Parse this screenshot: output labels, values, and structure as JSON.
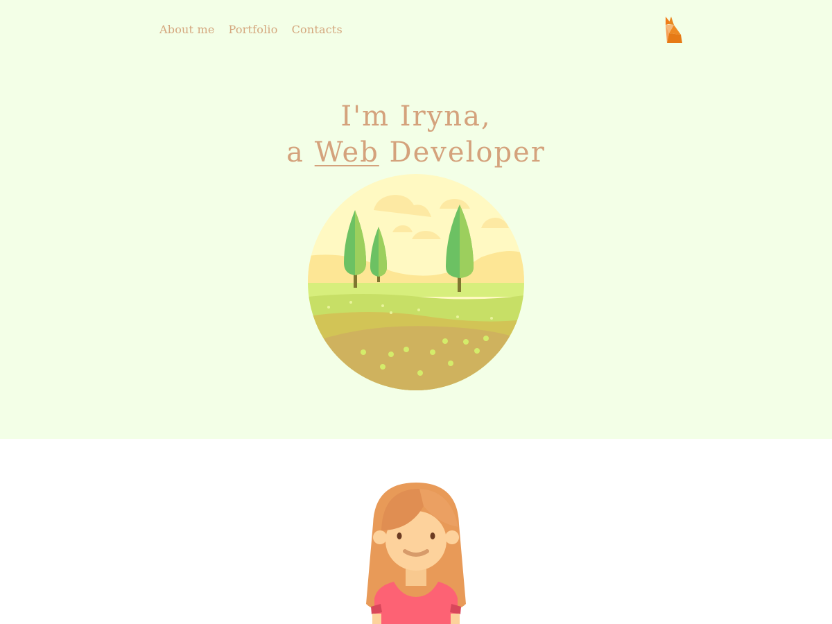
{
  "nav": {
    "items": [
      "About me",
      "Portfolio",
      "Contacts"
    ]
  },
  "logo": {
    "icon": "fox-logo-icon"
  },
  "hero": {
    "line1": "I'm Iryna,",
    "line2_prefix": "a ",
    "line2_accent": "Web",
    "line2_suffix": " Developer",
    "illustration": "landscape-illustration"
  },
  "about": {
    "avatar": "girl-avatar-illustration"
  },
  "colors": {
    "hero_background": "#f3ffe7",
    "text_accent": "#d4a77e",
    "page_background": "#ffffff"
  }
}
